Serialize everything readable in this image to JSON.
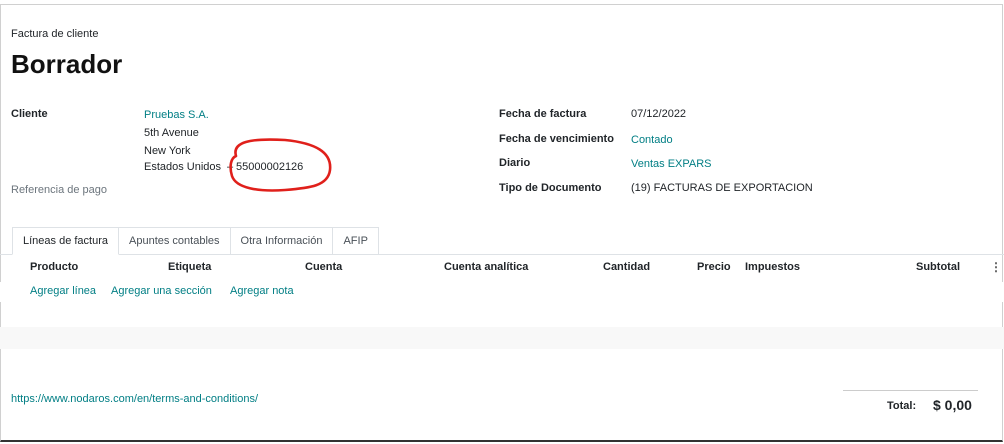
{
  "header": {
    "doc_type": "Factura de cliente",
    "status_title": "Borrador"
  },
  "customer": {
    "label": "Cliente",
    "name": "Pruebas S.A.",
    "address_line1": "5th Avenue",
    "address_line2": "New York",
    "country": "Estados Unidos",
    "separator": "–",
    "vat": "55000002126",
    "payment_ref_label": "Referencia de pago"
  },
  "invoice_info": {
    "date_label": "Fecha de factura",
    "date_value": "07/12/2022",
    "due_label": "Fecha de vencimiento",
    "due_value": "Contado",
    "journal_label": "Diario",
    "journal_value": "Ventas EXPARS",
    "doc_type_label": "Tipo de Documento",
    "doc_type_value": "(19) FACTURAS DE EXPORTACION"
  },
  "tabs": [
    {
      "label": "Líneas de factura"
    },
    {
      "label": "Apuntes contables"
    },
    {
      "label": "Otra Información"
    },
    {
      "label": "AFIP"
    }
  ],
  "table": {
    "columns": [
      "Producto",
      "Etiqueta",
      "Cuenta",
      "Cuenta analítica",
      "Cantidad",
      "Precio",
      "Impuestos",
      "Subtotal"
    ],
    "add_line": "Agregar línea",
    "add_section": "Agregar una sección",
    "add_note": "Agregar nota"
  },
  "footer": {
    "terms_url": "https://www.nodaros.com/en/terms-and-conditions/",
    "total_label": "Total:",
    "total_value": "$ 0,00"
  },
  "colors": {
    "link": "#017e84",
    "annotation": "#e0201b"
  },
  "icons": {
    "options": "vertical-ellipsis-icon"
  }
}
